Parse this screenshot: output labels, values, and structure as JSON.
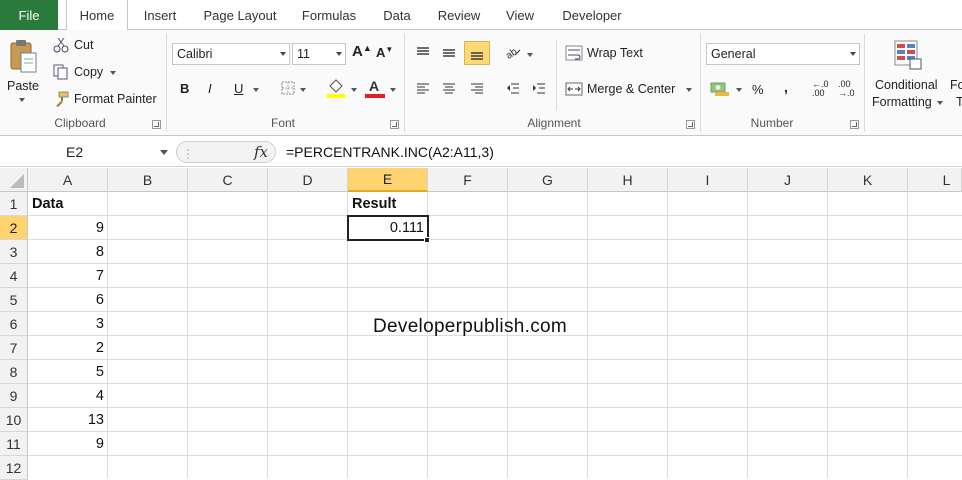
{
  "tabs": {
    "file": "File",
    "items": [
      "Home",
      "Insert",
      "Page Layout",
      "Formulas",
      "Data",
      "Review",
      "View",
      "Developer"
    ]
  },
  "ribbon": {
    "clipboard": {
      "paste": "Paste",
      "cut": "Cut",
      "copy": "Copy",
      "format_painter": "Format Painter",
      "label": "Clipboard"
    },
    "font": {
      "name": "Calibri",
      "size": "11",
      "bold": "B",
      "italic": "I",
      "underline": "U",
      "label": "Font",
      "highlight_color": "#ffff00",
      "font_color": "#e02020"
    },
    "alignment": {
      "wrap_text": "Wrap Text",
      "merge_center": "Merge & Center",
      "label": "Alignment"
    },
    "number": {
      "format": "General",
      "percent": "%",
      "comma": ",",
      "label": "Number"
    },
    "styles": {
      "conditional_line1": "Conditional",
      "conditional_line2": "Formatting",
      "cut_off_fo": "Fo",
      "cut_off_t": "T"
    }
  },
  "formula_bar": {
    "name_box": "E2",
    "fx": "fx",
    "formula": "=PERCENTRANK.INC(A2:A11,3)"
  },
  "sheet": {
    "columns": [
      "A",
      "B",
      "C",
      "D",
      "E",
      "F",
      "G",
      "H",
      "I",
      "J",
      "K",
      "L"
    ],
    "rows": [
      "1",
      "2",
      "3",
      "4",
      "5",
      "6",
      "7",
      "8",
      "9",
      "10",
      "11",
      "12"
    ],
    "A1": "Data",
    "E1": "Result",
    "E2": "0.111",
    "data_values": [
      "9",
      "8",
      "7",
      "6",
      "3",
      "2",
      "5",
      "4",
      "13",
      "9"
    ],
    "selected_cell": "E2",
    "watermark": "Developerpublish.com"
  }
}
